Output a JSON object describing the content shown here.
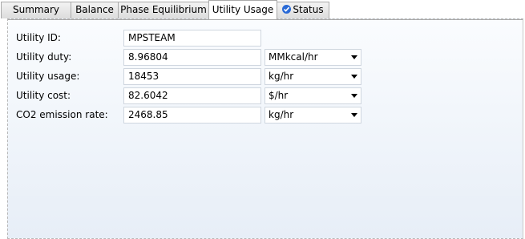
{
  "tabs": [
    {
      "label": "Summary",
      "active": false
    },
    {
      "label": "Balance",
      "active": false
    },
    {
      "label": "Phase Equilibrium",
      "active": false
    },
    {
      "label": "Utility Usage",
      "active": true
    },
    {
      "label": "Status",
      "active": false,
      "icon": "check-circle-icon"
    }
  ],
  "form": {
    "utility_id": {
      "label": "Utility ID:",
      "value": "MPSTEAM"
    },
    "utility_duty": {
      "label": "Utility duty:",
      "value": "8.96804",
      "unit": "MMkcal/hr"
    },
    "utility_usage": {
      "label": "Utility usage:",
      "value": "18453",
      "unit": "kg/hr"
    },
    "utility_cost": {
      "label": "Utility cost:",
      "value": "82.6042",
      "unit": "$/hr"
    },
    "co2_rate": {
      "label": "CO2 emission rate:",
      "value": "2468.85",
      "unit": "kg/hr"
    }
  },
  "colors": {
    "status_icon": "#2a6ad6",
    "panel_top": "#fafcfe",
    "panel_bottom": "#e7eef7"
  }
}
